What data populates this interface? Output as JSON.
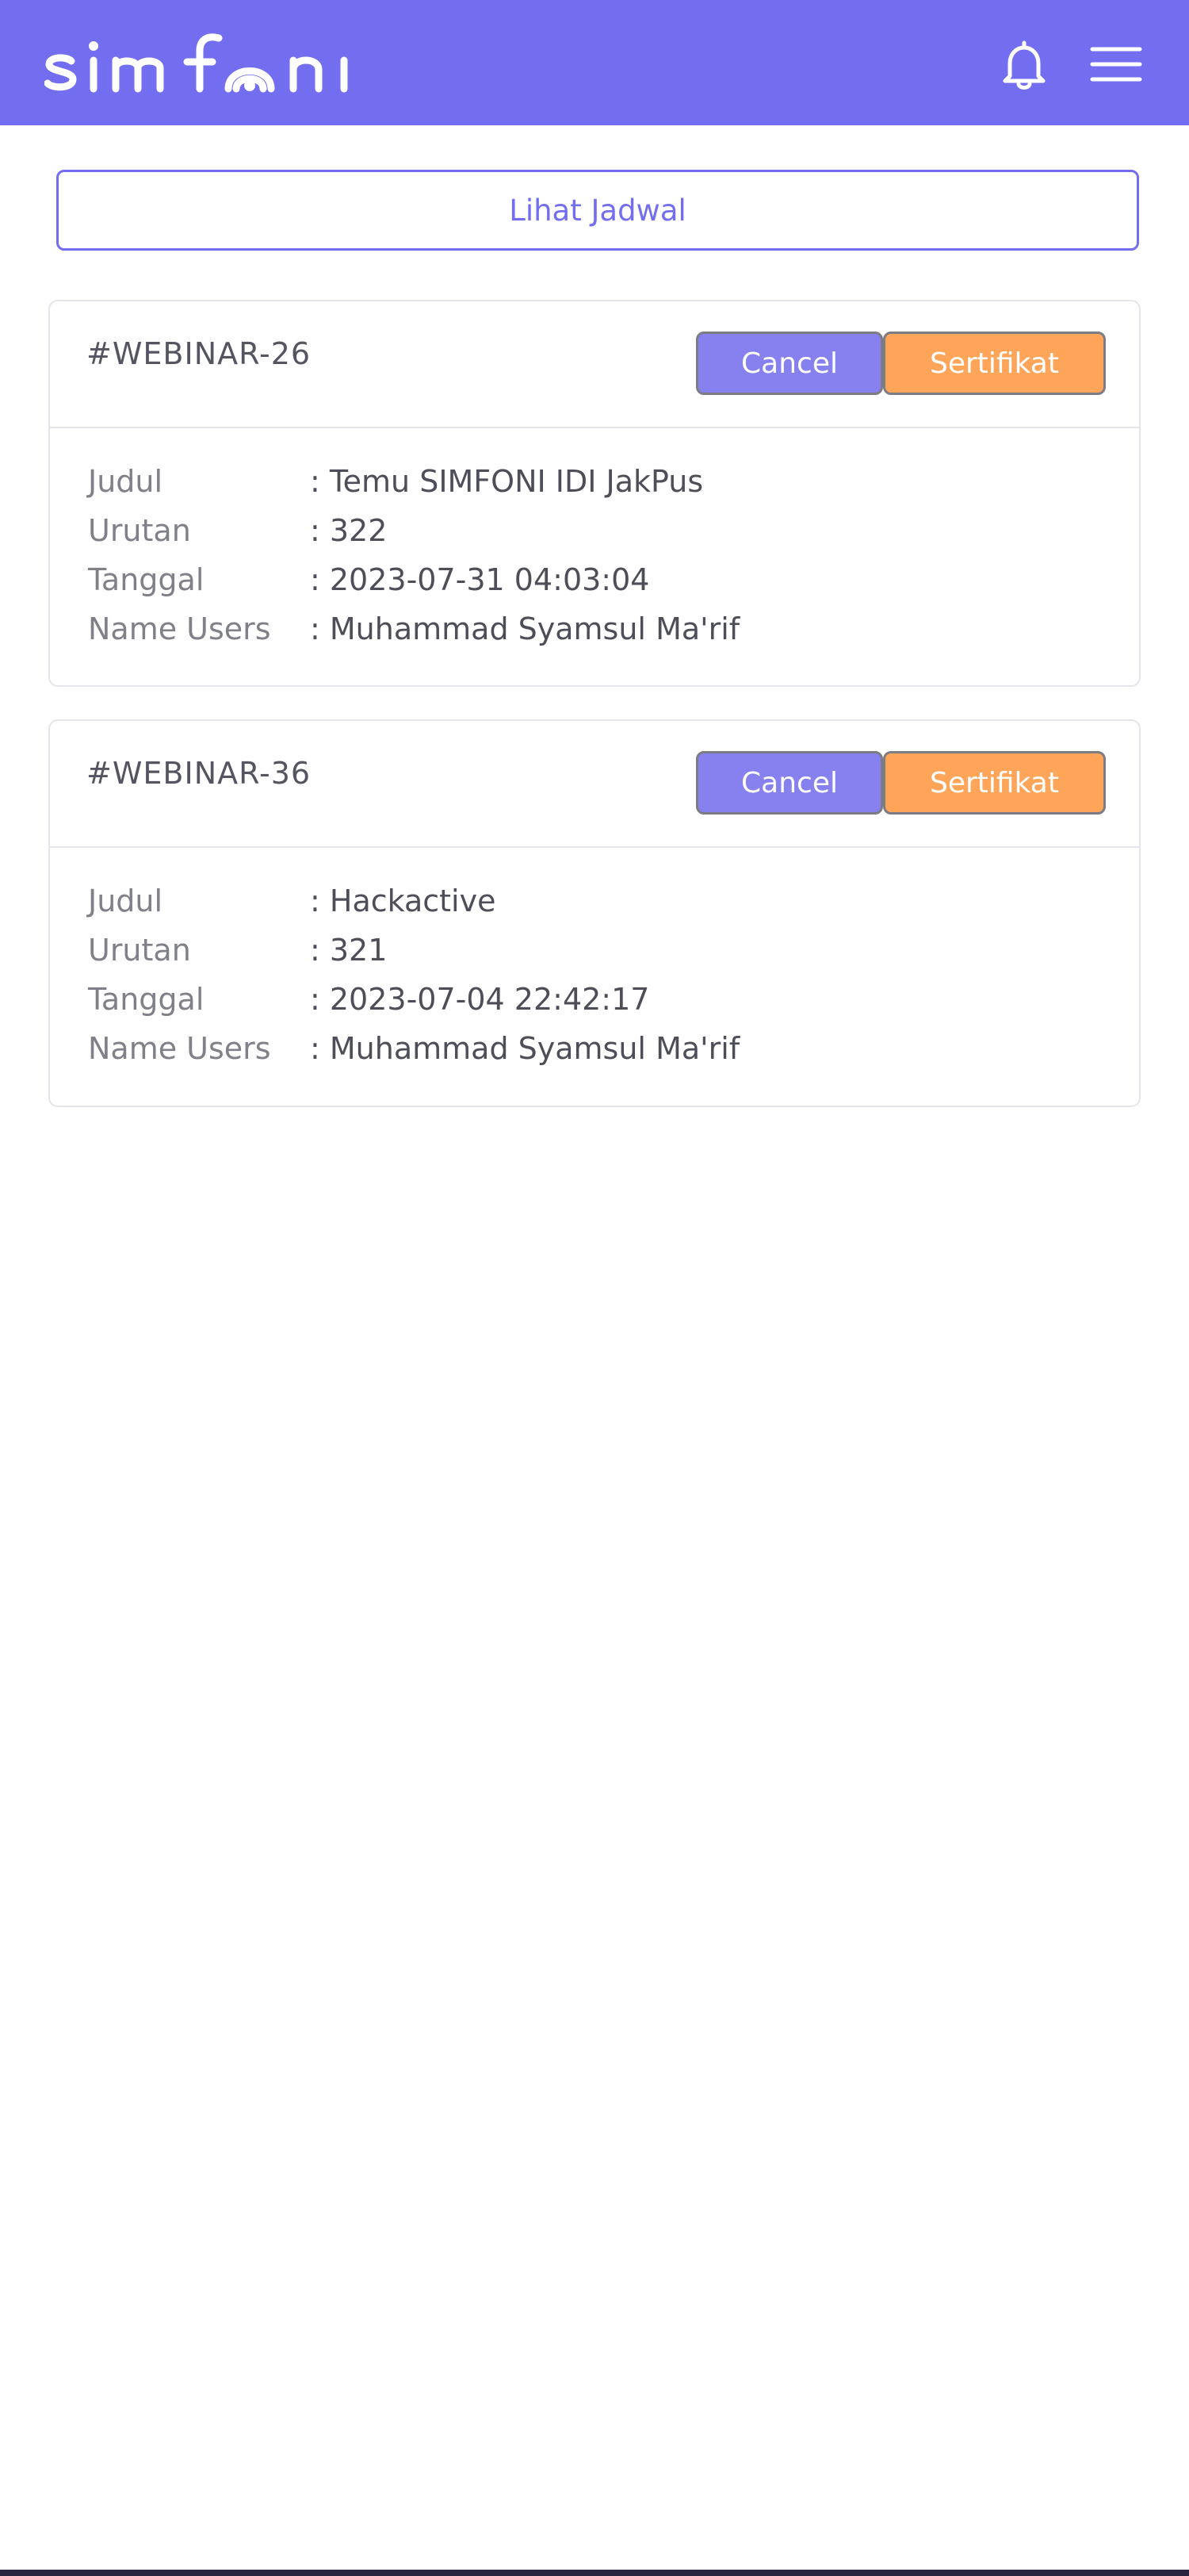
{
  "header": {
    "logo_text": "simfoni",
    "notification_icon": "bell-icon",
    "menu_icon": "hamburger-menu-icon",
    "background_color": "#736def"
  },
  "schedule_button": {
    "label": "Lihat Jadwal"
  },
  "labels": {
    "judul": "Judul",
    "urutan": "Urutan",
    "tanggal": "Tanggal",
    "name_users": "Name Users"
  },
  "webinars": [
    {
      "code": "#WEBINAR-26",
      "cancel_label": "Cancel",
      "certificate_label": "Sertifikat",
      "judul": ": Temu SIMFONI IDI JakPus",
      "urutan": ": 322",
      "tanggal": ": 2023-07-31 04:03:04",
      "name_users": ": Muhammad Syamsul Ma'rif"
    },
    {
      "code": "#WEBINAR-36",
      "cancel_label": "Cancel",
      "certificate_label": "Sertifikat",
      "judul": ": Hackactive",
      "urutan": ": 321",
      "tanggal": ": 2023-07-04 22:42:17",
      "name_users": ": Muhammad Syamsul Ma'rif"
    }
  ],
  "colors": {
    "primary": "#736def",
    "cancel_button": "#8681ee",
    "certificate_button": "#fea55a"
  }
}
